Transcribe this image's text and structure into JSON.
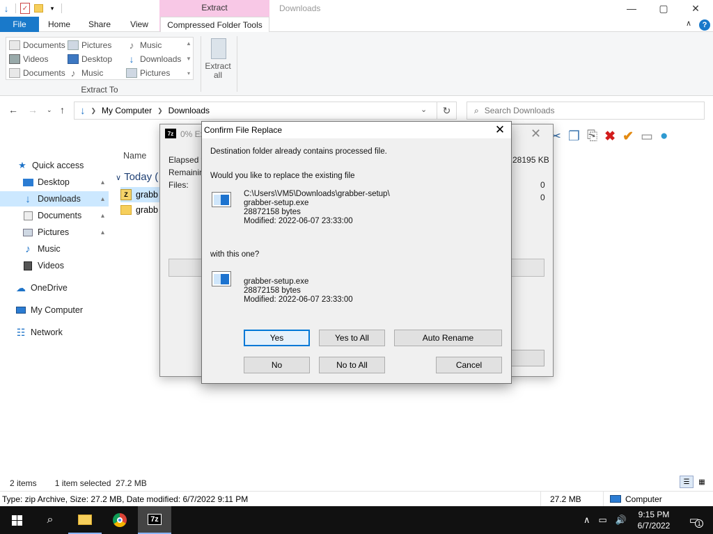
{
  "window": {
    "title": "Downloads",
    "context_tab": "Extract",
    "controls": {
      "minimize": "—",
      "maximize": "▢",
      "close": "✕"
    }
  },
  "ribbon": {
    "tabs": [
      "File",
      "Home",
      "Share",
      "View",
      "Compressed Folder Tools"
    ],
    "destinations": [
      [
        "Documents",
        "Pictures",
        "Music"
      ],
      [
        "Videos",
        "Desktop",
        "Downloads"
      ],
      [
        "Documents",
        "Music",
        "Pictures"
      ]
    ],
    "group_label": "Extract To",
    "extract_all": [
      "Extract",
      "all"
    ]
  },
  "address": {
    "crumbs": [
      "My Computer",
      "Downloads"
    ],
    "search_placeholder": "Search Downloads"
  },
  "nav": {
    "items": [
      {
        "label": "Quick access",
        "icon": "star-icon",
        "pinned": false
      },
      {
        "label": "Desktop",
        "icon": "desktop-icon",
        "pinned": true
      },
      {
        "label": "Downloads",
        "icon": "download-icon",
        "pinned": true,
        "selected": true
      },
      {
        "label": "Documents",
        "icon": "document-icon",
        "pinned": true
      },
      {
        "label": "Pictures",
        "icon": "pictures-icon",
        "pinned": true
      },
      {
        "label": "Music",
        "icon": "music-icon",
        "pinned": false
      },
      {
        "label": "Videos",
        "icon": "videos-icon",
        "pinned": false
      },
      {
        "label": "OneDrive",
        "icon": "cloud-icon",
        "pinned": false
      },
      {
        "label": "My Computer",
        "icon": "computer-icon",
        "pinned": false
      },
      {
        "label": "Network",
        "icon": "network-icon",
        "pinned": false
      }
    ]
  },
  "filelist": {
    "column_name": "Name",
    "group": "Today (",
    "rows": [
      "grabb",
      "grabb"
    ]
  },
  "progress": {
    "title": "0% Ex",
    "labels": [
      "Elapsed tir",
      "Remaining",
      "Files:"
    ],
    "size_value": "28195 KB",
    "count_1": "0",
    "count_2": "0",
    "button_tail": "l"
  },
  "dialog": {
    "title": "Confirm File Replace",
    "message": "Destination folder already contains processed file.",
    "question": "Would you like to replace the existing file",
    "existing": {
      "path": "C:\\Users\\VM5\\Downloads\\grabber-setup\\",
      "name": "grabber-setup.exe",
      "size": "28872158 bytes",
      "modified": "Modified: 2022-06-07 23:33:00"
    },
    "with_label": "with this one?",
    "incoming": {
      "name": "grabber-setup.exe",
      "size": "28872158 bytes",
      "modified": "Modified: 2022-06-07 23:33:00"
    },
    "buttons": {
      "yes": "Yes",
      "yes_all": "Yes to All",
      "auto_rename": "Auto Rename",
      "no": "No",
      "no_all": "No to All",
      "cancel": "Cancel"
    }
  },
  "status": {
    "items": "2 items",
    "selected": "1 item selected  27.2 MB",
    "info": "Type: zip Archive, Size: 27.2 MB, Date modified: 6/7/2022 9:11 PM",
    "size": "27.2 MB",
    "location": "Computer"
  },
  "taskbar": {
    "time": "9:15 PM",
    "date": "6/7/2022",
    "notifications": "1"
  }
}
